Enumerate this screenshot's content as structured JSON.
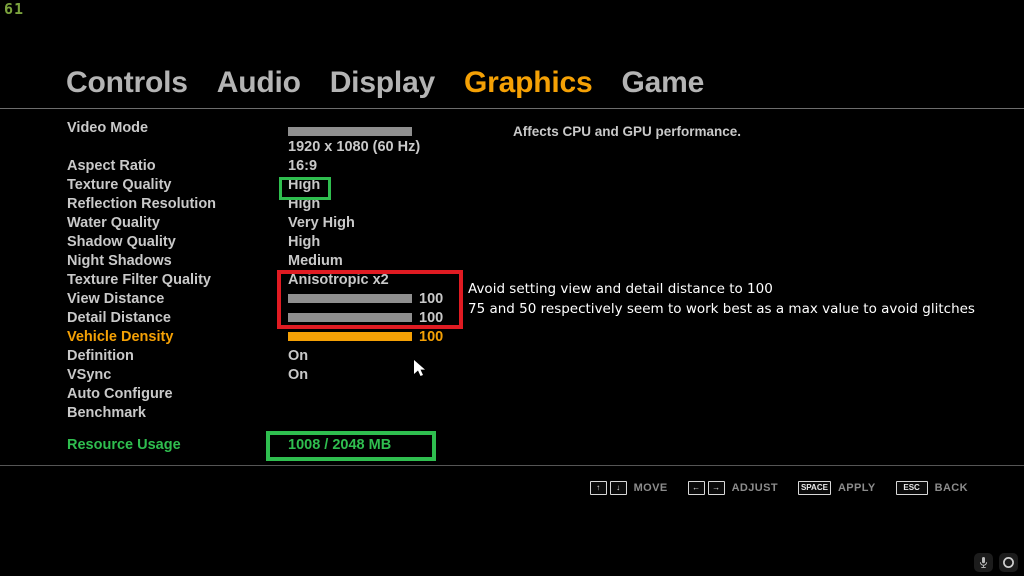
{
  "hud": {
    "fps": "61"
  },
  "tabs": [
    {
      "label": "Controls",
      "active": false
    },
    {
      "label": "Audio",
      "active": false
    },
    {
      "label": "Display",
      "active": false
    },
    {
      "label": "Graphics",
      "active": true
    },
    {
      "label": "Game",
      "active": false
    }
  ],
  "description": "Affects CPU and GPU performance.",
  "settings": [
    {
      "label": "Video Mode",
      "value": "",
      "type": "bar-only",
      "fill": 100
    },
    {
      "label": "",
      "value": "1920 x 1080 (60 Hz)",
      "type": "text"
    },
    {
      "label": "Aspect Ratio",
      "value": "16:9",
      "type": "text"
    },
    {
      "label": "Texture Quality",
      "value": "High",
      "type": "text"
    },
    {
      "label": "Reflection Resolution",
      "value": "High",
      "type": "text"
    },
    {
      "label": "Water Quality",
      "value": "Very High",
      "type": "text"
    },
    {
      "label": "Shadow Quality",
      "value": "High",
      "type": "text"
    },
    {
      "label": "Night Shadows",
      "value": "Medium",
      "type": "text"
    },
    {
      "label": "Texture Filter Quality",
      "value": "Anisotropic x2",
      "type": "text"
    },
    {
      "label": "View Distance",
      "value": "100",
      "type": "slider",
      "fill": 100
    },
    {
      "label": "Detail Distance",
      "value": "100",
      "type": "slider",
      "fill": 100
    },
    {
      "label": "Vehicle Density",
      "value": "100",
      "type": "slider",
      "fill": 100,
      "selected": true
    },
    {
      "label": "Definition",
      "value": "On",
      "type": "text"
    },
    {
      "label": "VSync",
      "value": "On",
      "type": "text"
    },
    {
      "label": "Auto Configure",
      "value": "",
      "type": "text"
    },
    {
      "label": "Benchmark",
      "value": "",
      "type": "text"
    }
  ],
  "resource": {
    "label": "Resource Usage",
    "value": "1008 / 2048 MB"
  },
  "annotations": {
    "line1": "Avoid setting view and detail distance to 100",
    "line2": "75 and 50 respectively seem to work best as a max value to avoid glitches",
    "highlight_green_label": "Texture Quality highlight",
    "highlight_red_label": "Texture Filter Quality, View Distance and Detail Distance highlight",
    "highlight_resource_label": "Resource Usage highlight"
  },
  "hints": [
    {
      "keys": [
        "↑",
        "↓"
      ],
      "label": "MOVE",
      "wide": false
    },
    {
      "keys": [
        "←",
        "→"
      ],
      "label": "ADJUST",
      "wide": false
    },
    {
      "keys": [
        "SPACE"
      ],
      "label": "APPLY",
      "wide": true
    },
    {
      "keys": [
        "ESC"
      ],
      "label": "BACK",
      "wide": true
    }
  ],
  "corner_buttons": [
    {
      "icon": "microphone-icon"
    },
    {
      "icon": "record-circle-icon"
    }
  ],
  "colors": {
    "accent_orange": "#f5a105",
    "green": "#2fbe4f",
    "red": "#e01b22",
    "text_gray": "#c9c9c9",
    "fps_green": "#7ba33d"
  }
}
